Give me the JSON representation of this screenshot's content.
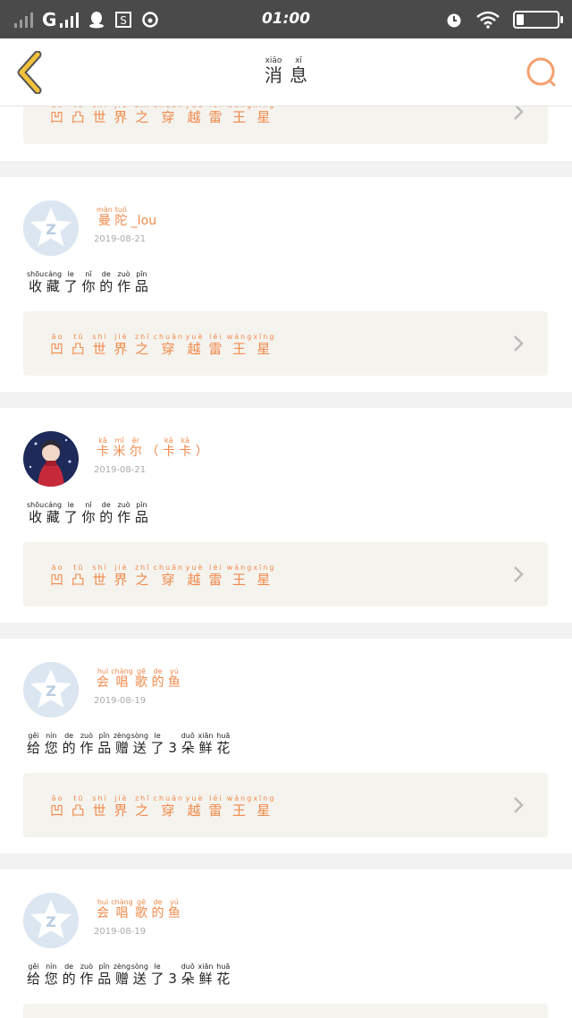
{
  "status_bar": {
    "network": "G",
    "time": "01:00"
  },
  "header": {
    "title_chars": [
      {
        "char": "消",
        "pinyin": "xiāo"
      },
      {
        "char": "息",
        "pinyin": "xī"
      }
    ]
  },
  "work_title": [
    {
      "char": "凹",
      "pinyin": "āo"
    },
    {
      "char": "凸",
      "pinyin": "tū"
    },
    {
      "char": "世",
      "pinyin": "shì"
    },
    {
      "char": "界",
      "pinyin": "jiè"
    },
    {
      "char": "之",
      "pinyin": "zhī"
    },
    {
      "char": "穿",
      "pinyin": "chuān"
    },
    {
      "char": "越",
      "pinyin": "yuè"
    },
    {
      "char": "雷",
      "pinyin": "léi"
    },
    {
      "char": "王",
      "pinyin": "wáng"
    },
    {
      "char": "星",
      "pinyin": "xīng"
    }
  ],
  "messages": [
    {
      "user_name": [
        {
          "char": "曼",
          "pinyin": "màn"
        },
        {
          "char": "陀",
          "pinyin": "tuó"
        },
        {
          "char": "_lou",
          "pinyin": ""
        }
      ],
      "date": "2019-08-21",
      "action": [
        {
          "char": "收",
          "pinyin": "shōu"
        },
        {
          "char": "藏",
          "pinyin": "cáng"
        },
        {
          "char": "了",
          "pinyin": "le"
        },
        {
          "char": "你",
          "pinyin": "nǐ"
        },
        {
          "char": "的",
          "pinyin": "de"
        },
        {
          "char": "作",
          "pinyin": "zuò"
        },
        {
          "char": "品",
          "pinyin": "pǐn"
        }
      ],
      "avatar": "default"
    },
    {
      "user_name": [
        {
          "char": "卡",
          "pinyin": "kǎ"
        },
        {
          "char": "米",
          "pinyin": "mǐ"
        },
        {
          "char": "尔",
          "pinyin": "ěr"
        },
        {
          "char": "（",
          "pinyin": ""
        },
        {
          "char": "卡",
          "pinyin": "kǎ"
        },
        {
          "char": "卡",
          "pinyin": "kǎ"
        },
        {
          "char": "）",
          "pinyin": ""
        }
      ],
      "date": "2019-08-21",
      "action": [
        {
          "char": "收",
          "pinyin": "shōu"
        },
        {
          "char": "藏",
          "pinyin": "cáng"
        },
        {
          "char": "了",
          "pinyin": "le"
        },
        {
          "char": "你",
          "pinyin": "nǐ"
        },
        {
          "char": "的",
          "pinyin": "de"
        },
        {
          "char": "作",
          "pinyin": "zuò"
        },
        {
          "char": "品",
          "pinyin": "pǐn"
        }
      ],
      "avatar": "photo"
    },
    {
      "user_name": [
        {
          "char": "会",
          "pinyin": "huì"
        },
        {
          "char": "唱",
          "pinyin": "chàng"
        },
        {
          "char": "歌",
          "pinyin": "gē"
        },
        {
          "char": "的",
          "pinyin": "de"
        },
        {
          "char": "鱼",
          "pinyin": "yú"
        }
      ],
      "date": "2019-08-19",
      "action": [
        {
          "char": "给",
          "pinyin": "gěi"
        },
        {
          "char": "您",
          "pinyin": "nín"
        },
        {
          "char": "的",
          "pinyin": "de"
        },
        {
          "char": "作",
          "pinyin": "zuò"
        },
        {
          "char": "品",
          "pinyin": "pǐn"
        },
        {
          "char": "赠",
          "pinyin": "zèng"
        },
        {
          "char": "送",
          "pinyin": "sòng"
        },
        {
          "char": "了",
          "pinyin": "le"
        },
        {
          "char": "3",
          "pinyin": ""
        },
        {
          "char": "朵",
          "pinyin": "duǒ"
        },
        {
          "char": "鲜",
          "pinyin": "xiān"
        },
        {
          "char": "花",
          "pinyin": "huā"
        }
      ],
      "avatar": "default"
    },
    {
      "user_name": [
        {
          "char": "会",
          "pinyin": "huì"
        },
        {
          "char": "唱",
          "pinyin": "chàng"
        },
        {
          "char": "歌",
          "pinyin": "gē"
        },
        {
          "char": "的",
          "pinyin": "de"
        },
        {
          "char": "鱼",
          "pinyin": "yú"
        }
      ],
      "date": "2019-08-19",
      "action": [
        {
          "char": "给",
          "pinyin": "gěi"
        },
        {
          "char": "您",
          "pinyin": "nín"
        },
        {
          "char": "的",
          "pinyin": "de"
        },
        {
          "char": "作",
          "pinyin": "zuò"
        },
        {
          "char": "品",
          "pinyin": "pǐn"
        },
        {
          "char": "赠",
          "pinyin": "zèng"
        },
        {
          "char": "送",
          "pinyin": "sòng"
        },
        {
          "char": "了",
          "pinyin": "le"
        },
        {
          "char": "3",
          "pinyin": ""
        },
        {
          "char": "朵",
          "pinyin": "duǒ"
        },
        {
          "char": "鲜",
          "pinyin": "xiān"
        },
        {
          "char": "花",
          "pinyin": "huā"
        }
      ],
      "avatar": "default"
    }
  ],
  "icons": {
    "back": "chevron-left-icon",
    "search": "search-icon",
    "item_arrow": "chevron-right-icon",
    "avatar_default": "qzone-star-icon"
  },
  "colors": {
    "accent": "#f08a4b",
    "back_icon": "#f3c23a",
    "card_bg": "#f5f3ee",
    "avatar_default_bg": "#dbe6f1"
  }
}
